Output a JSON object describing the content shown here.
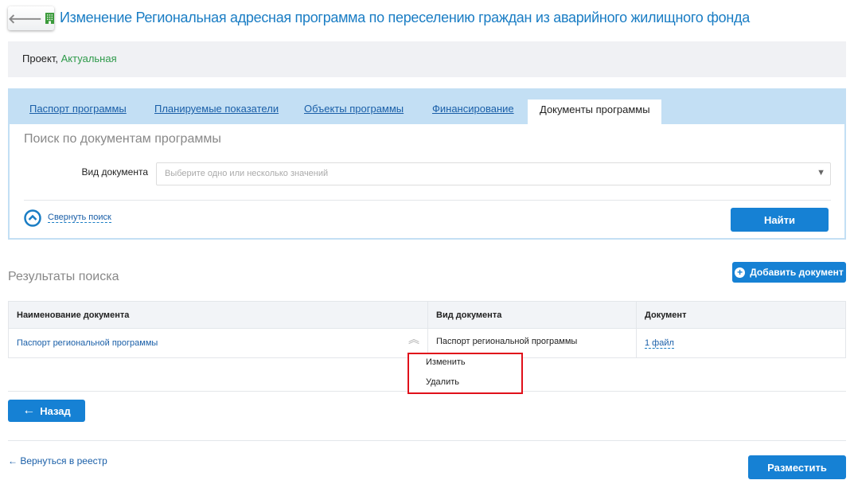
{
  "header": {
    "title": "Изменение Региональная адресная программа по переселению граждан из аварийного жилищного фонда"
  },
  "status": {
    "state": "Проект,",
    "version": "Актуальная"
  },
  "tabs": [
    {
      "label": "Паспорт программы"
    },
    {
      "label": "Планируемые показатели"
    },
    {
      "label": "Объекты программы"
    },
    {
      "label": "Финансирование"
    },
    {
      "label": "Документы программы",
      "active": true
    }
  ],
  "search": {
    "heading": "Поиск по документам программы",
    "doc_type_label": "Вид документа",
    "doc_type_placeholder": "Выберите одно или несколько значений",
    "collapse_label": "Свернуть поиск",
    "find_label": "Найти"
  },
  "results": {
    "heading": "Результаты поиска",
    "add_label": "Добавить документ",
    "columns": [
      "Наименование документа",
      "Вид документа",
      "Документ"
    ],
    "rows": [
      {
        "name": "Паспорт региональной программы",
        "type": "Паспорт региональной программы",
        "file": "1 файл"
      }
    ]
  },
  "context_menu": {
    "items": [
      "Изменить",
      "Удалить"
    ]
  },
  "footer": {
    "back_label": "Назад",
    "return_label": "← Вернуться в реестр",
    "publish_label": "Разместить"
  }
}
